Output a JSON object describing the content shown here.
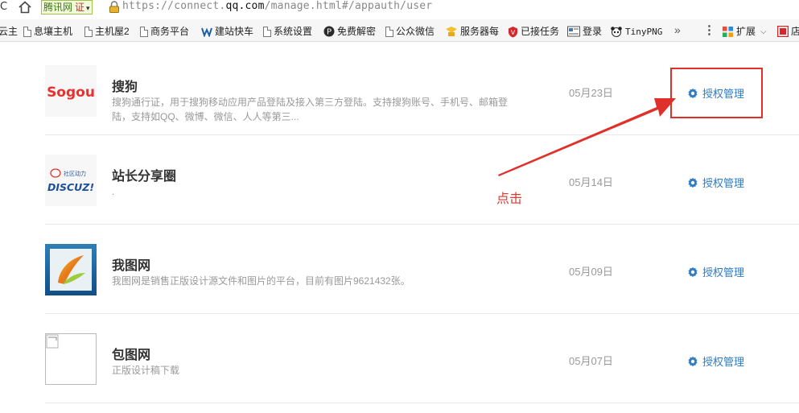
{
  "address_bar": {
    "reload_glyph": "C",
    "site_name": "腾讯网",
    "cert_label": "证",
    "url_prefix": "https://connect.",
    "url_domain": "qq.com",
    "url_path": "/manage.html#/appauth/user"
  },
  "bookmarks": [
    {
      "label": "云主",
      "icon": "none"
    },
    {
      "label": "息壤主机",
      "icon": "page-icon"
    },
    {
      "label": "主机屋2",
      "icon": "page-icon"
    },
    {
      "label": "商务平台",
      "icon": "page-icon"
    },
    {
      "label": "建站快车",
      "icon": "jianzhan-icon"
    },
    {
      "label": "系统设置",
      "icon": "page-icon"
    },
    {
      "label": "免费解密",
      "icon": "decrypt-icon"
    },
    {
      "label": "公众微信",
      "icon": "page-icon"
    },
    {
      "label": "服务器每",
      "icon": "server-icon"
    },
    {
      "label": "已接任务",
      "icon": "task-icon"
    },
    {
      "label": "登录",
      "icon": "login-icon"
    },
    {
      "label": "TinyPNG",
      "icon": "panda-icon"
    },
    {
      "label": "扩展",
      "icon": "extensions-icon"
    },
    {
      "label": "店",
      "icon": "store-icon"
    }
  ],
  "bookmark_more": "»",
  "menu_glyph": "⋮",
  "apps": [
    {
      "name": "搜狗",
      "desc": "搜狗通行证，用于搜狗移动应用产品登陆及接入第三方登陆。支持搜狗账号、手机号、邮箱登陆，支持如QQ、微博、微信、人人等第三...",
      "date": "05月23日",
      "logo": "sogou-logo",
      "action": "授权管理"
    },
    {
      "name": "站长分享圈",
      "desc": ".",
      "date": "05月14日",
      "logo": "discuz-logo",
      "action": "授权管理"
    },
    {
      "name": "我图网",
      "desc": "我图网是销售正版设计源文件和图片的平台，目前有图片9621432张。",
      "date": "05月09日",
      "logo": "ooopic-logo",
      "action": "授权管理"
    },
    {
      "name": "包图网",
      "desc": "正版设计稿下载",
      "date": "05月07日",
      "logo": "broken-image",
      "action": "授权管理"
    }
  ],
  "annotation": {
    "text": "点击",
    "color": "#e0302a"
  },
  "colors": {
    "link": "#2d7bc4",
    "annotation_red": "#e0302a"
  },
  "logo_text": {
    "sogou": "Sogou",
    "discuz": "DISCUZ!",
    "discuz_tag": "社区动力"
  }
}
